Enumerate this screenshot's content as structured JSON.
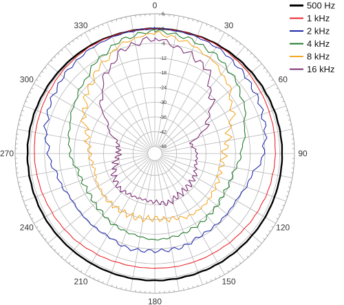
{
  "chart_data": {
    "type": "polar-line",
    "angle_unit": "degrees",
    "angle_direction": "clockwise",
    "angle_zero": "top",
    "angular_ticks": [
      0,
      30,
      60,
      90,
      120,
      150,
      180,
      210,
      240,
      270,
      300,
      330
    ],
    "angular_tick_labels": [
      "0",
      "30",
      "60",
      "90",
      "120",
      "150",
      "180",
      "210",
      "240",
      "270",
      "300",
      "330"
    ],
    "radial_unit": "dB",
    "radial_range": [
      -48,
      6
    ],
    "radial_ticks": [
      6,
      0,
      -6,
      -12,
      -18,
      -24,
      -30,
      -36,
      -42,
      -48
    ],
    "radial_tick_labels": [
      "6",
      "0",
      "-6",
      "-12",
      "-18",
      "-24",
      "-30",
      "-36",
      "-42",
      "-48"
    ],
    "grid": true,
    "legend_position": "top-right",
    "angles": [
      0,
      15,
      30,
      45,
      60,
      75,
      90,
      105,
      120,
      135,
      150,
      165,
      180,
      195,
      210,
      225,
      240,
      255,
      270,
      285,
      300,
      315,
      330,
      345
    ],
    "series": [
      {
        "name": "500 Hz",
        "color": "#000000",
        "values": [
          0,
          0,
          0.3,
          0.5,
          0.7,
          0.9,
          1.0,
          1.0,
          1.0,
          0.9,
          0.9,
          0.8,
          0.8,
          0.8,
          0.8,
          0.9,
          1.0,
          1.0,
          1.0,
          0.9,
          0.7,
          0.5,
          0.3,
          0
        ]
      },
      {
        "name": "1 kHz",
        "color": "#e8262b",
        "values": [
          0,
          0,
          0,
          -0.4,
          -1.0,
          -1.4,
          -1.8,
          -2.2,
          -2.8,
          -3.4,
          -3.8,
          -4.0,
          -4.2,
          -4.1,
          -3.6,
          -3.0,
          -2.6,
          -2.2,
          -1.8,
          -1.4,
          -1.0,
          -0.4,
          0,
          0
        ]
      },
      {
        "name": "2 kHz",
        "color": "#1f2aa8",
        "values": [
          0,
          -0.3,
          -0.8,
          -2.0,
          -3.2,
          -4.6,
          -6.6,
          -10.8,
          -12.6,
          -12.6,
          -12.6,
          -11.2,
          -11.2,
          -10.8,
          -12.2,
          -12.2,
          -12.2,
          -10.4,
          -7.6,
          -5.0,
          -3.2,
          -1.8,
          -0.8,
          -0.3
        ]
      },
      {
        "name": "4 kHz",
        "color": "#1e7a2a",
        "values": [
          -1.0,
          -2.0,
          -3.6,
          -6.0,
          -9.2,
          -13.0,
          -15.8,
          -18.0,
          -18.4,
          -17.6,
          -16.8,
          -16.2,
          -15.8,
          -16.8,
          -17.4,
          -18.8,
          -19.6,
          -19.0,
          -16.4,
          -14.8,
          -12.6,
          -10.0,
          -6.0,
          -2.6
        ]
      },
      {
        "name": "8 kHz",
        "color": "#f5a623",
        "values": [
          -2.0,
          -3.6,
          -6.0,
          -9.4,
          -14.6,
          -19.8,
          -22.6,
          -23.4,
          -22.6,
          -21.8,
          -21.8,
          -23.4,
          -24.4,
          -23.8,
          -23.8,
          -23.8,
          -24.4,
          -25.4,
          -24.4,
          -22.4,
          -17.6,
          -13.0,
          -8.4,
          -4.0
        ]
      },
      {
        "name": "16 kHz",
        "color": "#7b2c74",
        "values": [
          -4.0,
          -7.2,
          -10.0,
          -18.4,
          -26.2,
          -35.6,
          -33.8,
          -33.6,
          -32.2,
          -31.8,
          -31.4,
          -30.0,
          -31.2,
          -31.6,
          -31.4,
          -30.6,
          -31.8,
          -34.2,
          -36.2,
          -35.4,
          -29.0,
          -20.0,
          -12.2,
          -6.2
        ]
      }
    ]
  }
}
